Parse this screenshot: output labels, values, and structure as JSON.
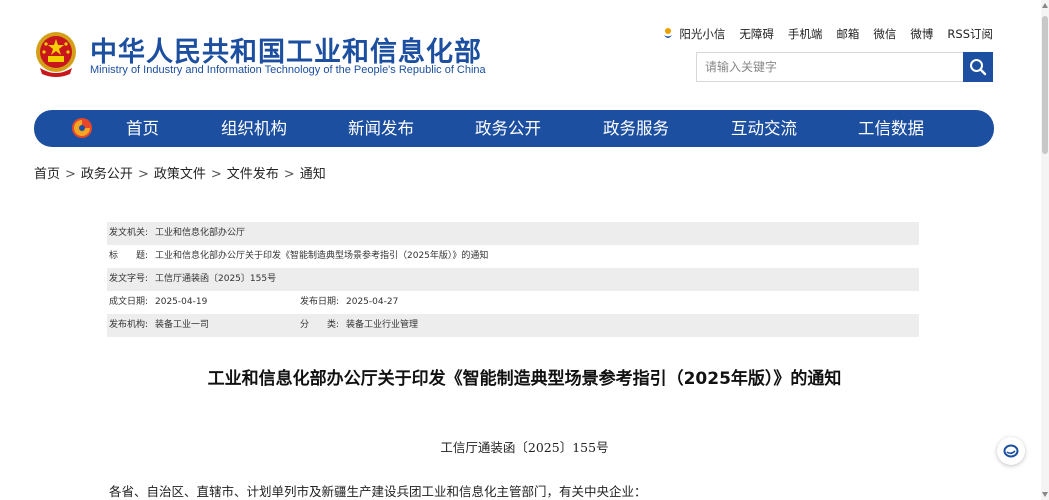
{
  "header": {
    "site_title": "中华人民共和国工业和信息化部",
    "site_subtitle": "Ministry of Industry and Information Technology of the People's Republic of China",
    "emblem_icon": "national-emblem-icon",
    "brand_color": "#1d4fa0",
    "top_links": [
      "阳光小信",
      "无障碍",
      "手机端",
      "邮箱",
      "微信",
      "微博",
      "RSS订阅"
    ],
    "search": {
      "placeholder": "请输入关键字",
      "value": ""
    }
  },
  "nav": {
    "items": [
      "首页",
      "组织机构",
      "新闻发布",
      "政务公开",
      "政务服务",
      "互动交流",
      "工信数据"
    ]
  },
  "breadcrumb": {
    "items": [
      "首页",
      "政务公开",
      "政策文件",
      "文件发布",
      "通知"
    ],
    "separator": ">"
  },
  "meta": {
    "issuer_label": "发文机关:",
    "issuer": "工业和信息化部办公厅",
    "title_label": "标　　题:",
    "title": "工业和信息化部办公厅关于印发《智能制造典型场景参考指引（2025年版）》的通知",
    "doc_no_label": "发文字号:",
    "doc_no": "工信厅通装函〔2025〕155号",
    "created_label": "成文日期:",
    "created": "2025-04-19",
    "published_label": "发布日期:",
    "published": "2025-04-27",
    "org_label": "发布机构:",
    "org": "装备工业一司",
    "category_label": "分　　类:",
    "category": "装备工业行业管理"
  },
  "document": {
    "title": "工业和信息化部办公厅关于印发《智能制造典型场景参考指引（2025年版）》的通知",
    "number": "工信厅通装函〔2025〕155号",
    "salutation": "各省、自治区、直辖市、计划单列市及新疆生产建设兵团工业和信息化主管部门，有关中央企业："
  }
}
